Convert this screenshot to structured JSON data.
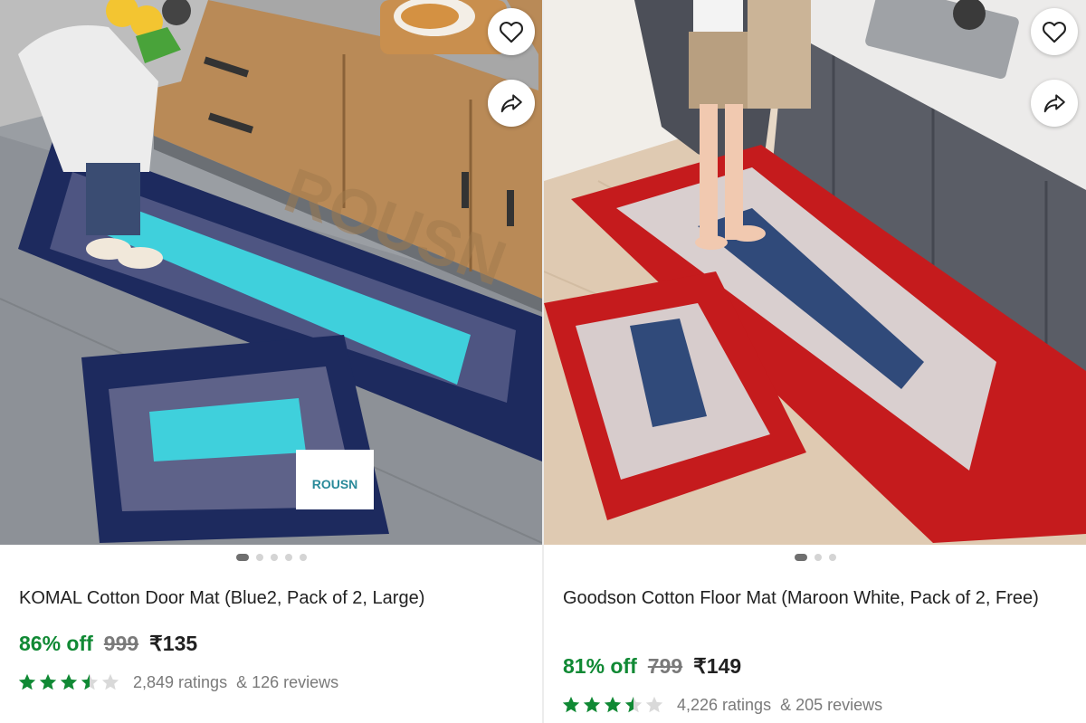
{
  "products": [
    {
      "title": "KOMAL Cotton Door Mat (Blue2, Pack of 2, Large)",
      "discount": "86% off",
      "mrp": "999",
      "price": "₹135",
      "rating_value": 3.5,
      "ratings": "2,849 ratings",
      "reviews": "& 126 reviews",
      "image_dots": 5,
      "active_dot": 0,
      "photo_label": "ROUSN"
    },
    {
      "title": "Goodson Cotton Floor Mat (Maroon White, Pack of 2, Free)",
      "discount": "81% off",
      "mrp": "799",
      "price": "₹149",
      "rating_value": 3.5,
      "ratings": "4,226 ratings",
      "reviews": "& 205 reviews",
      "image_dots": 3,
      "active_dot": 0
    }
  ],
  "icons": {
    "wishlist": "heart-icon",
    "share": "share-icon",
    "rating": "star-icon"
  },
  "colors": {
    "discount": "#108934",
    "star": "#108934",
    "star_empty": "#d9d9d9",
    "text": "#212121",
    "muted": "#7a7a7a"
  }
}
